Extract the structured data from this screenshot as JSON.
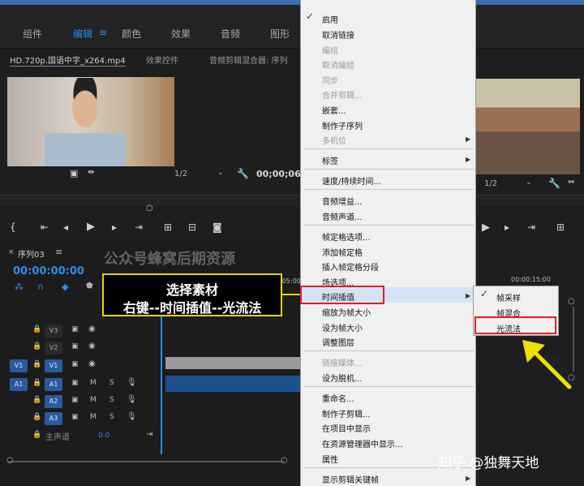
{
  "workspace_tabs": [
    "组件",
    "编辑",
    "颜色",
    "效果",
    "音频",
    "图形"
  ],
  "source_panel": {
    "tabs": [
      "HD.720p.国语中字_x264.mp4",
      "效果控件",
      "音频剪辑混合器: 序列"
    ],
    "resolution": "1/2",
    "timecode": "00;00;06"
  },
  "program_panel": {
    "resolution": "1/2"
  },
  "timeline": {
    "sequence_tab": "序列03",
    "timecode": "00:00:00:00",
    "ruler_mark_1": ":05:00",
    "ruler_mark_2": "00:00:15:00",
    "tracks": [
      {
        "target": "",
        "label": "V3"
      },
      {
        "target": "",
        "label": "V2"
      },
      {
        "target": "V1",
        "label": "V1"
      },
      {
        "target": "A1",
        "label": "A1"
      },
      {
        "target": "",
        "label": "A2"
      },
      {
        "target": "",
        "label": "A3"
      }
    ],
    "master_label": "主声道",
    "master_value": "0.0",
    "m_label": "M",
    "s_label": "S"
  },
  "watermark": "公众号蜂窝后期资源",
  "annotation": {
    "line1": "选择素材",
    "line2": "右键--时间插值--光流法"
  },
  "context_menu": {
    "items": [
      {
        "label": "启用",
        "checked": true
      },
      {
        "label": "取消链接"
      },
      {
        "label": "编组",
        "disabled": true
      },
      {
        "label": "取消编组",
        "disabled": true
      },
      {
        "label": "同步",
        "disabled": true
      },
      {
        "label": "合并剪辑...",
        "disabled": true
      },
      {
        "label": "嵌套..."
      },
      {
        "label": "制作子序列"
      },
      {
        "label": "多机位",
        "disabled": true
      },
      {
        "label": "标签"
      },
      {
        "label": "速度/持续时间..."
      },
      {
        "label": "音频增益..."
      },
      {
        "label": "音频声道..."
      },
      {
        "label": "帧定格选项..."
      },
      {
        "label": "添加帧定格"
      },
      {
        "label": "插入帧定格分段"
      },
      {
        "label": "场选项..."
      },
      {
        "label": "时间插值"
      },
      {
        "label": "缩放为帧大小"
      },
      {
        "label": "设为帧大小"
      },
      {
        "label": "调整图层"
      },
      {
        "label": "链接媒体...",
        "disabled": true
      },
      {
        "label": "设为脱机..."
      },
      {
        "label": "重命名..."
      },
      {
        "label": "制作子剪辑..."
      },
      {
        "label": "在项目中显示"
      },
      {
        "label": "在资源管理器中显示..."
      },
      {
        "label": "属性"
      },
      {
        "label": "显示剪辑关键帧"
      }
    ]
  },
  "submenu": {
    "items": [
      {
        "label": "帧采样",
        "checked": true
      },
      {
        "label": "帧混合"
      },
      {
        "label": "光流法"
      }
    ]
  },
  "credit": "知乎 @独舞天地",
  "colors": {
    "accent": "#2d8ceb",
    "annotation_border": "#e6d400",
    "highlight": "#e02020"
  }
}
